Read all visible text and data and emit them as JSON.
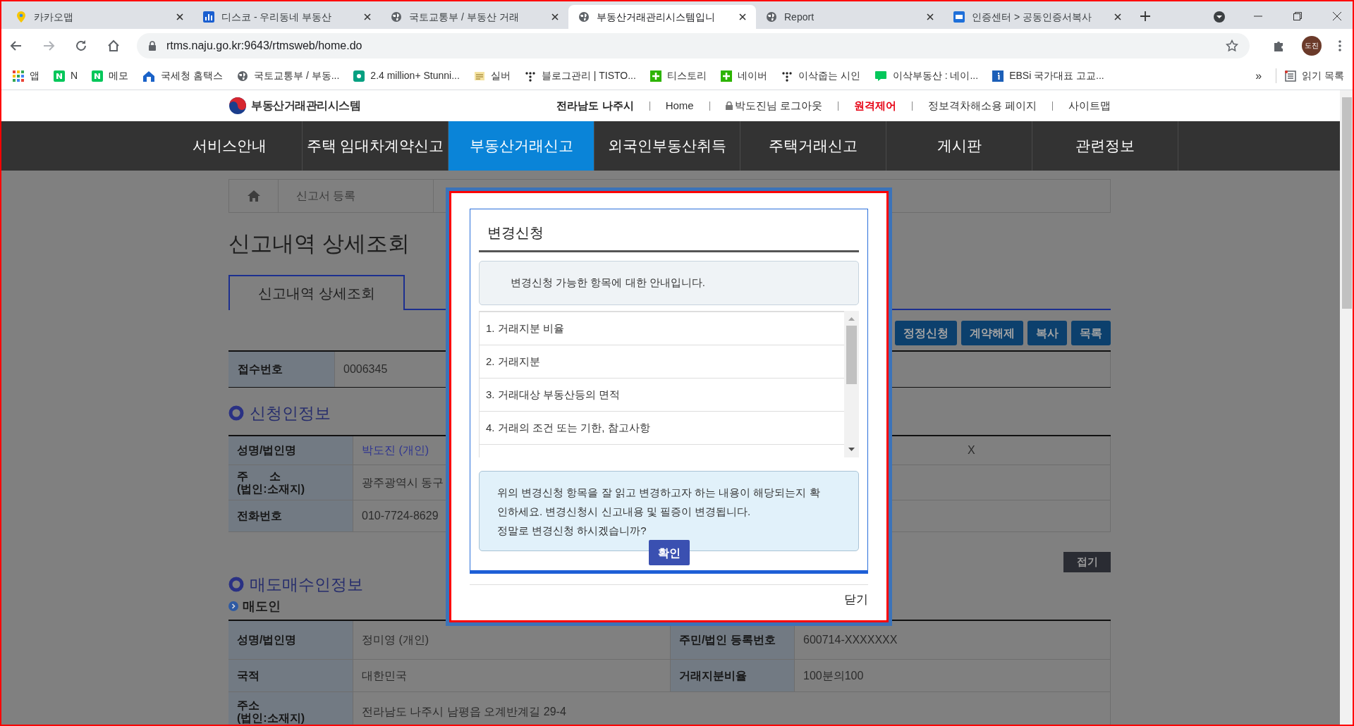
{
  "browser": {
    "tabs": [
      {
        "title": "카카오맵",
        "kind": "pin",
        "selected": false
      },
      {
        "title": "디스코 - 우리동네 부동산",
        "kind": "chart",
        "selected": false
      },
      {
        "title": "국토교통부 / 부동산 거래",
        "kind": "globe",
        "selected": false
      },
      {
        "title": "부동산거래관리시스템입니",
        "kind": "globe",
        "selected": true
      },
      {
        "title": "Report",
        "kind": "globe",
        "selected": false
      },
      {
        "title": "인증센터 > 공동인증서복사",
        "kind": "square",
        "selected": false
      }
    ],
    "address": "rtms.naju.go.kr:9643/rtmsweb/home.do",
    "profile": "도진",
    "bookmarks": [
      {
        "label": "앱",
        "kind": "apps"
      },
      {
        "label": "N",
        "kind": "green"
      },
      {
        "label": "메모",
        "kind": "green"
      },
      {
        "label": "국세청 홈택스",
        "kind": "house"
      },
      {
        "label": "국토교통부 / 부동...",
        "kind": "globe"
      },
      {
        "label": "2.4 million+ Stunni...",
        "kind": "px"
      },
      {
        "label": "실버",
        "kind": "note"
      },
      {
        "label": "블로그관리 | TISTO...",
        "kind": "dots"
      },
      {
        "label": "티스토리",
        "kind": "plus"
      },
      {
        "label": "네이버",
        "kind": "plus"
      },
      {
        "label": "이삭줍는 시인",
        "kind": "dots"
      },
      {
        "label": "이삭부동산 : 네이...",
        "kind": "blog"
      },
      {
        "label": "EBSi 국가대표 고교...",
        "kind": "info"
      }
    ],
    "more": "»",
    "reading_list": "읽기 목록"
  },
  "site": {
    "logo_text": "부동산거래관리시스템",
    "top_links": [
      {
        "label": "전라남도 나주시",
        "kind": "region"
      },
      {
        "label": "Home",
        "kind": "plain"
      },
      {
        "label": "박도진님 로그아웃",
        "kind": "lock"
      },
      {
        "label": "원격제어",
        "kind": "alert"
      },
      {
        "label": "정보격차해소용 페이지",
        "kind": "plain"
      },
      {
        "label": "사이트맵",
        "kind": "plain"
      }
    ],
    "nav": [
      {
        "label": "서비스안내",
        "selected": false
      },
      {
        "label": "주택 임대차계약신고",
        "selected": false
      },
      {
        "label": "부동산거래신고",
        "selected": true
      },
      {
        "label": "외국인부동산취득",
        "selected": false
      },
      {
        "label": "주택거래신고",
        "selected": false
      },
      {
        "label": "게시판",
        "selected": false
      },
      {
        "label": "관련정보",
        "selected": false
      }
    ]
  },
  "breadcrumb": "신고서 등록",
  "page_title": "신고내역 상세조회",
  "tabs": [
    {
      "label": "신고내역 상세조회",
      "selected": true
    }
  ],
  "actions": [
    "정정신청",
    "계약해제",
    "복사",
    "목록"
  ],
  "receipt": {
    "label": "접수번호",
    "value": "0006345"
  },
  "applicant": {
    "heading": "신청인정보",
    "rows": [
      {
        "label": "성명/법인명",
        "value": "박도진 (개인)",
        "kind": "link",
        "right_value": "X"
      },
      {
        "label": "주 소",
        "note": "(법인:소재지)",
        "value": "광주광역시 동구",
        "kind": "plain"
      },
      {
        "label": "전화번호",
        "value": "010-7724-8629",
        "kind": "plain"
      }
    ]
  },
  "collapse_button": "접기",
  "parties": {
    "heading": "매도매수인정보",
    "subheading": "매도인",
    "rows": [
      [
        {
          "label": "성명/법인명",
          "value": "정미영 (개인)"
        },
        {
          "label": "주민/법인 등록번호",
          "value": "600714-XXXXXXX"
        }
      ],
      [
        {
          "label": "국적",
          "value": "대한민국"
        },
        {
          "label": "거래지분비율",
          "value": "100분의100"
        }
      ],
      [
        {
          "label": "주소",
          "note": "(법인:소재지)",
          "value": "전라남도 나주시 남평읍 오계반계길 29-4"
        }
      ]
    ]
  },
  "modal": {
    "title": "변경신청",
    "intro": "변경신청 가능한 항목에 대한 안내입니다.",
    "items": [
      "1. 거래지분 비율",
      "2. 거래지분",
      "3. 거래대상 부동산등의 면적",
      "4. 거래의 조건 또는 기한, 참고사항"
    ],
    "notice": [
      "위의 변경신청 항목을 잘 읽고 변경하고자 하는 내용이 해당되는지 확인하세요. 변경신청시 신고내용 및 필증이 변경됩니다.",
      "정말로 변경신청 하시겠습니까?"
    ],
    "confirm": "확인",
    "close": "닫기"
  }
}
